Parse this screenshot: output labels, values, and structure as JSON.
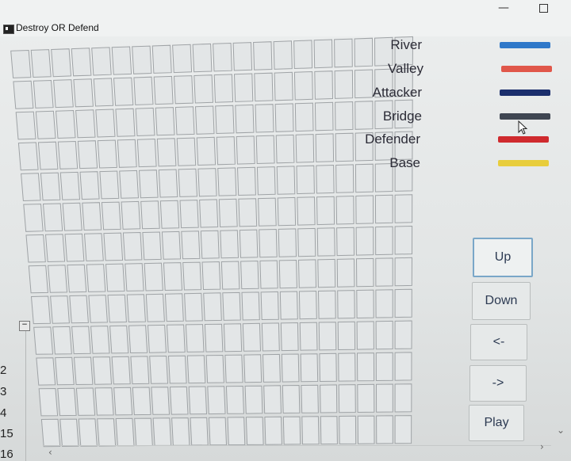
{
  "window": {
    "title": "Destroy OR Defend",
    "minimize_glyph": "—"
  },
  "grid": {
    "columns": 20,
    "rows": 13
  },
  "legend": [
    {
      "label": "River",
      "color": "#2f78c9"
    },
    {
      "label": "Valley",
      "color": "#e0574a"
    },
    {
      "label": "Attacker",
      "color": "#1b2f6d"
    },
    {
      "label": "Bridge",
      "color": "#3f4652"
    },
    {
      "label": "Defender",
      "color": "#cf2a2e"
    },
    {
      "label": "Base",
      "color": "#e8cd3c"
    }
  ],
  "controls": {
    "up": "Up",
    "down": "Down",
    "left": "<-",
    "right": "->",
    "play": "Play"
  },
  "side_numbers": [
    "2",
    "3",
    "4",
    "15",
    "16"
  ],
  "scroll_glyphs": {
    "vertical_thumb": "−",
    "left": "‹",
    "right": "›",
    "corner": "⌄"
  }
}
